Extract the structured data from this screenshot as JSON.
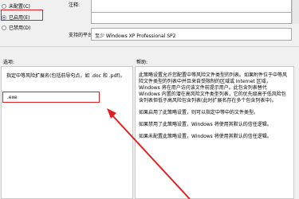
{
  "state": {
    "options": [
      {
        "label": "未配置(C)",
        "selected": false
      },
      {
        "label": "已启用(E)",
        "selected": true
      },
      {
        "label": "已禁用(D)",
        "selected": false
      }
    ]
  },
  "comment": {
    "label": "注释:"
  },
  "supported": {
    "label": "支持的平台:",
    "value": "至少 Windows XP Professional SP2"
  },
  "options_section": {
    "label": "选项:",
    "instruction": "指定中等风险扩展名(包括前导句点，如 .doc 和 .pdf)。",
    "input_value": ".exe"
  },
  "help_section": {
    "label": "帮助:",
    "paragraphs": [
      "此策略设置允许您配置中等风险文件类型的列表。如果附件位于中等风险文件类型的列表中并且来自受限制的区域或 Internet 区域，Windows 将在用户访问该文件前提示用户。此包含列表替代 Windows 内置的潜在高风险文件类型列表，它的优先级高于低风险包含列表但低于高风险包含列表(此时扩展名存在多个包含列表中)。",
      "如果启用了此策略设置，则可以指定中等中的文件类型。",
      "如果禁用了此策略设置，Windows 将使用其默认的信任逻辑。",
      "如果未配置此策略设置，Windows 将使用其默认的信任逻辑。"
    ]
  },
  "colors": {
    "annotation": "#e02020",
    "radio_dot": "#1f4fa8"
  }
}
